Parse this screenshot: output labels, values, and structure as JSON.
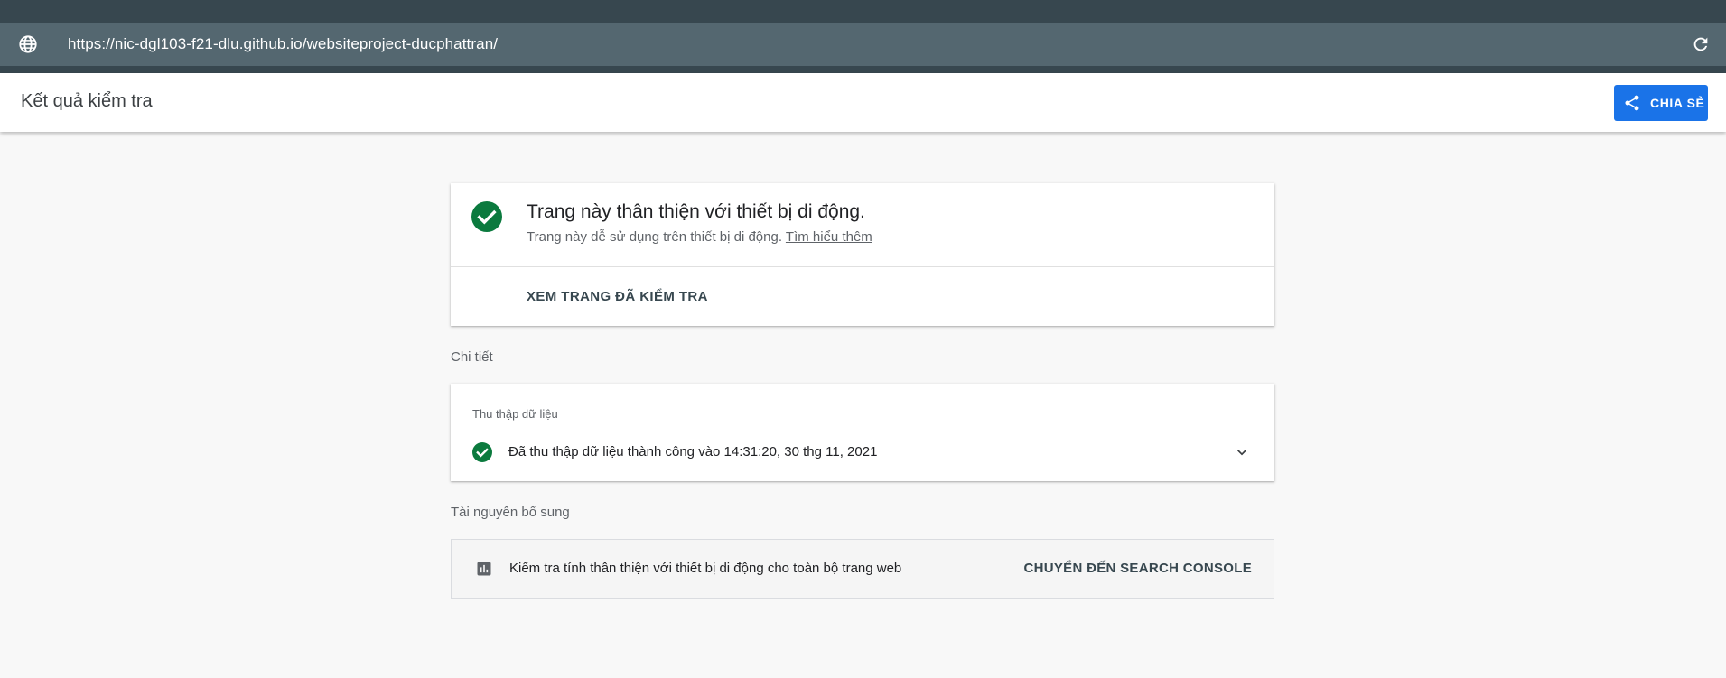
{
  "urlbar": {
    "url": "https://nic-dgl103-f21-dlu.github.io/websiteproject-ducphattran/",
    "globe_icon": "globe-icon",
    "reload_icon": "reload-icon"
  },
  "header": {
    "title": "Kết quả kiểm tra",
    "share_label": "CHIA SẺ",
    "share_icon": "share-icon"
  },
  "result": {
    "title": "Trang này thân thiện với thiết bị di động.",
    "subtitle": "Trang này dễ sử dụng trên thiết bị di động.",
    "learn_more": "Tìm hiểu thêm",
    "view_page_label": "XEM TRANG ĐÃ KIỂM TRA",
    "status_icon": "check-circle-icon"
  },
  "details": {
    "section_label": "Chi tiết",
    "label": "Thu thập dữ liệu",
    "status": "Đã thu thập dữ liệu thành công vào 14:31:20, 30 thg 11, 2021",
    "status_icon": "check-circle-icon",
    "expand_icon": "chevron-down-icon"
  },
  "resources": {
    "section_label": "Tài nguyên bổ sung",
    "text": "Kiểm tra tính thân thiện với thiết bị di động cho toàn bộ trang web",
    "button_label": "CHUYỂN ĐẾN SEARCH CONSOLE",
    "icon": "bar-chart-icon"
  },
  "colors": {
    "urlbar_bg": "#37474f",
    "urlbar_field": "#546770",
    "accent_blue": "#1a73e8",
    "success_green": "#0b7a3e"
  }
}
